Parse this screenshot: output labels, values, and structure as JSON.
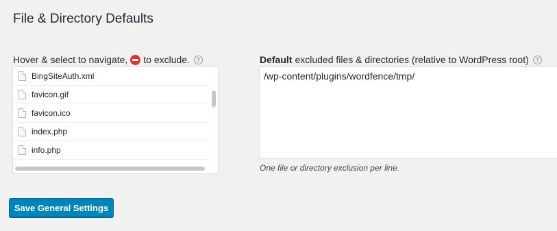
{
  "section": {
    "title": "File & Directory Defaults"
  },
  "browser": {
    "label_before": "Hover & select to navigate,",
    "label_after": "to exclude.",
    "help_glyph": "?",
    "files": [
      {
        "name": "BingSiteAuth.xml"
      },
      {
        "name": "favicon.gif"
      },
      {
        "name": "favicon.ico"
      },
      {
        "name": "index.php"
      },
      {
        "name": "info.php"
      }
    ]
  },
  "exclusions": {
    "label_bold": "Default",
    "label_rest": "excluded files & directories (relative to WordPress root)",
    "help_glyph": "?",
    "value": "/wp-content/plugins/wordfence/tmp/",
    "hint": "One file or directory exclusion per line."
  },
  "actions": {
    "save_label": "Save General Settings"
  },
  "colors": {
    "primary": "#0085ba",
    "exclude": "#dc3232",
    "background": "#f1f1f1"
  },
  "icons": {
    "exclude": "minus-circle-icon",
    "help": "question-circle-icon",
    "file": "file-icon"
  }
}
